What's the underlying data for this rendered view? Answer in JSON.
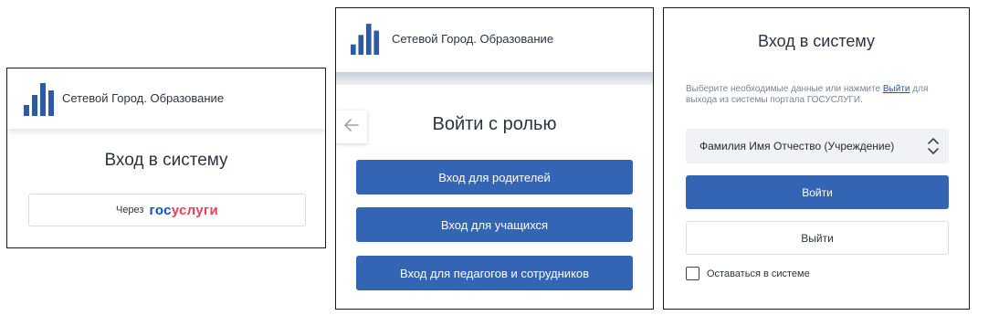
{
  "brand": {
    "name": "Сетевой Город. Образование",
    "logo_color": "#2d5aa6"
  },
  "panel1": {
    "title": "Вход в систему",
    "gosuslugi_button": {
      "via_label": "Через",
      "logo_part1": "гос",
      "logo_part2": "услуги"
    }
  },
  "panel2": {
    "title": "Войти с ролью",
    "back_icon": "arrow-left-icon",
    "roles": [
      {
        "label": "Вход для родителей"
      },
      {
        "label": "Вход для учащихся"
      },
      {
        "label": "Вход для педагогов и сотрудников"
      }
    ]
  },
  "panel3": {
    "title": "Вход в систему",
    "info_before": "Выберите необходимые данные или нажмите ",
    "info_link": "Выйти",
    "info_after": " для выхода из системы портала ГОСУСЛУГИ.",
    "select_value": "Фамилия Имя Отчество (Учреждение)",
    "login_button": "Войти",
    "exit_button": "Выйти",
    "remember_label": "Оставаться в системе",
    "remember_checked": false
  },
  "colors": {
    "primary": "#3464b4",
    "gos_blue": "#0d4cd3",
    "gos_red": "#ee3f58"
  }
}
